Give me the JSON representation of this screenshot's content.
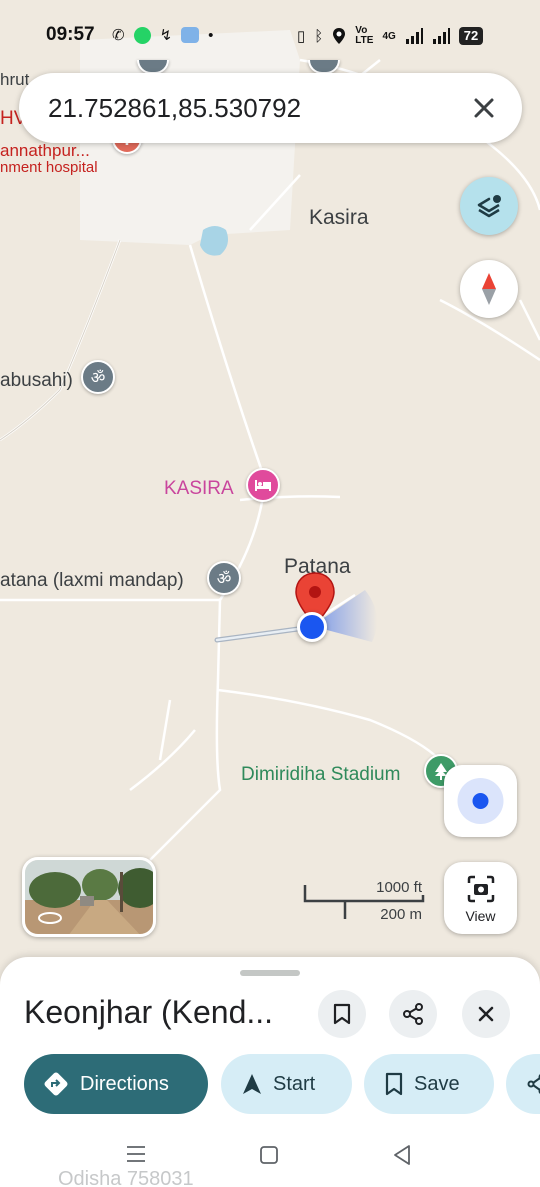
{
  "status_bar": {
    "time": "09:57",
    "network": "4G",
    "battery": "72",
    "icons": [
      "phone-icon",
      "whatsapp-icon",
      "missed-call-icon",
      "weather-icon",
      "dot-icon",
      "vibrate-icon",
      "bluetooth-icon",
      "location-icon",
      "volte-icon",
      "signal-icon",
      "battery-icon"
    ]
  },
  "search": {
    "query": "21.752861,85.530792"
  },
  "map": {
    "labels": {
      "kasira_town": "Kasira",
      "abusahi": "abusahi)",
      "kasira_poi": "KASIRA",
      "patana": "Patana",
      "laxmi_mandap": "atana (laxmi mandap)",
      "stadium": "Dimiridiha Stadium",
      "hospital_1": "annathpur...",
      "hospital_2": "nment hospital",
      "top_left_1": "hrut",
      "top_left_2": "HV"
    },
    "colors": {
      "background": "#efe9df",
      "road": "#ffffff",
      "water": "#a8d4e6",
      "pin_red": "#ea4335",
      "location_blue": "#1a56f0",
      "temple_gray": "#6b7b86",
      "hotel_pink": "#e04a9c",
      "park_green": "#3e9b67"
    }
  },
  "scale": {
    "imperial": "1000 ft",
    "metric": "200 m"
  },
  "controls": {
    "view_label": "View"
  },
  "sheet": {
    "title": "Keonjhar (Kend...",
    "directions_label": "Directions",
    "start_label": "Start",
    "save_label": "Save",
    "address_peek": "Odisha 758031"
  }
}
